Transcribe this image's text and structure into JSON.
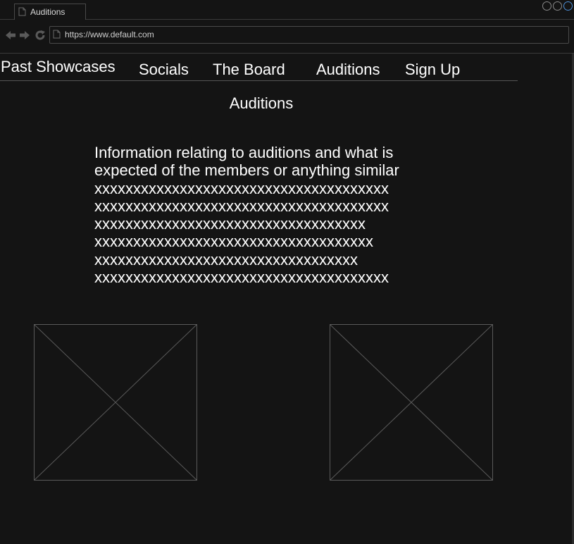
{
  "browser": {
    "tab_title": "Auditions",
    "url": "https://www.default.com"
  },
  "site_nav": {
    "items": [
      "Past Showcases",
      "Socials",
      "The Board",
      "Auditions",
      "Sign Up"
    ]
  },
  "page": {
    "title": "Auditions",
    "info_lines": [
      "Information relating to auditions and what is",
      "expected of the members or anything similar",
      "xxxxxxxxxxxxxxxxxxxxxxxxxxxxxxxxxxxxxx",
      "xxxxxxxxxxxxxxxxxxxxxxxxxxxxxxxxxxxxxx",
      "xxxxxxxxxxxxxxxxxxxxxxxxxxxxxxxxxxx",
      "xxxxxxxxxxxxxxxxxxxxxxxxxxxxxxxxxxxx",
      "xxxxxxxxxxxxxxxxxxxxxxxxxxxxxxxxxx",
      "xxxxxxxxxxxxxxxxxxxxxxxxxxxxxxxxxxxxxx"
    ]
  },
  "colors": {
    "background": "#141414",
    "text": "#ffffff",
    "border": "#4a4a4a",
    "accent": "#4d8fd6"
  }
}
